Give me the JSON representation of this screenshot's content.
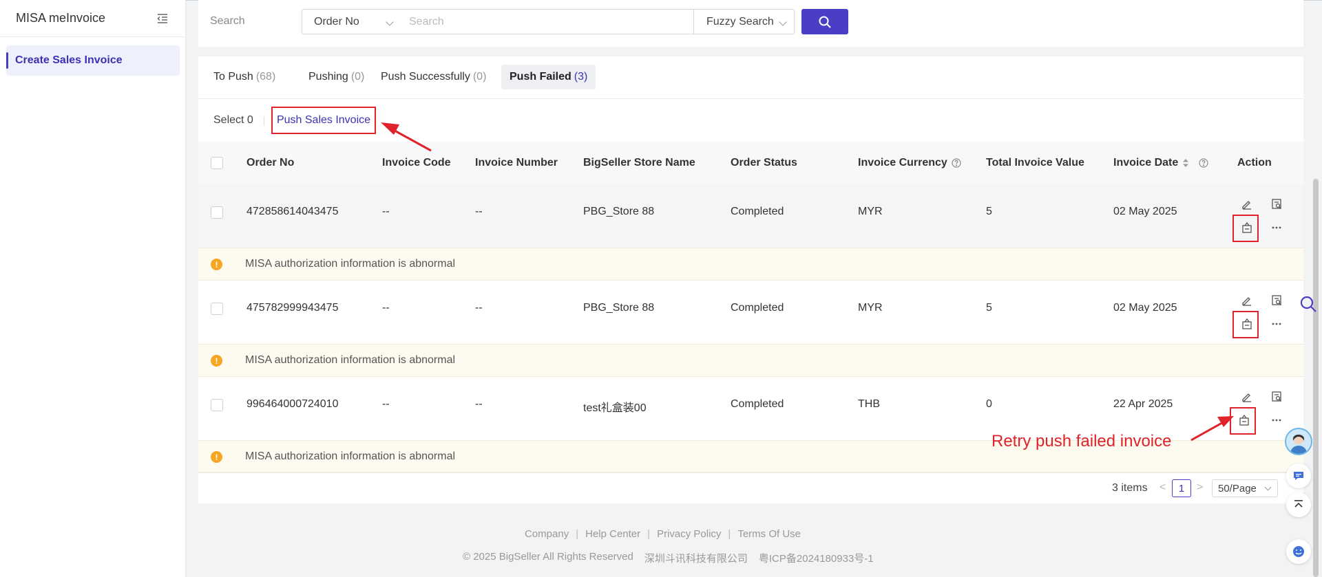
{
  "sidebar": {
    "title": "MISA meInvoice",
    "items": [
      {
        "label": "Create Sales Invoice",
        "active": true
      }
    ]
  },
  "search": {
    "label": "Search",
    "field_select": "Order No",
    "placeholder": "Search",
    "mode_select": "Fuzzy Search"
  },
  "tabs": [
    {
      "label": "To Push",
      "count": "(68)",
      "active": false
    },
    {
      "label": "Pushing",
      "count": "(0)",
      "active": false
    },
    {
      "label": "Push Successfully",
      "count": "(0)",
      "active": false
    },
    {
      "label": "Push Failed",
      "count": "(3)",
      "active": true
    }
  ],
  "toolbar": {
    "select_count": "Select 0",
    "push_label": "Push Sales Invoice"
  },
  "table": {
    "columns": [
      "Order No",
      "Invoice Code",
      "Invoice Number",
      "BigSeller Store Name",
      "Order Status",
      "Invoice Currency",
      "Total Invoice Value",
      "Invoice Date",
      "Action"
    ],
    "rows": [
      {
        "order_no": "472858614043475",
        "invoice_code": "--",
        "invoice_number": "--",
        "store": "PBG_Store 88",
        "status": "Completed",
        "currency": "MYR",
        "total": "5",
        "date": "02 May 2025",
        "error": "MISA authorization information is abnormal"
      },
      {
        "order_no": "475782999943475",
        "invoice_code": "--",
        "invoice_number": "--",
        "store": "PBG_Store 88",
        "status": "Completed",
        "currency": "MYR",
        "total": "5",
        "date": "02 May 2025",
        "error": "MISA authorization information is abnormal"
      },
      {
        "order_no": "996464000724010",
        "invoice_code": "--",
        "invoice_number": "--",
        "store": "test礼盒装00",
        "status": "Completed",
        "currency": "THB",
        "total": "0",
        "date": "22 Apr 2025",
        "error": "MISA authorization information is abnormal"
      }
    ]
  },
  "pagination": {
    "total": "3 items",
    "prev": "<",
    "page": "1",
    "next": ">",
    "page_size": "50/Page"
  },
  "footer": {
    "links": [
      "Company",
      "Help Center",
      "Privacy Policy",
      "Terms Of Use"
    ],
    "copyright": "© 2025 BigSeller All Rights Reserved",
    "company": "深圳斗讯科技有限公司",
    "icp": "粤ICP备2024180933号-1"
  },
  "annotation": {
    "text": "Retry push failed invoice",
    "color": "#e0222a"
  },
  "colors": {
    "accent": "#4a3ec6",
    "warning": "#f5a623",
    "annotation": "#e0222a"
  }
}
